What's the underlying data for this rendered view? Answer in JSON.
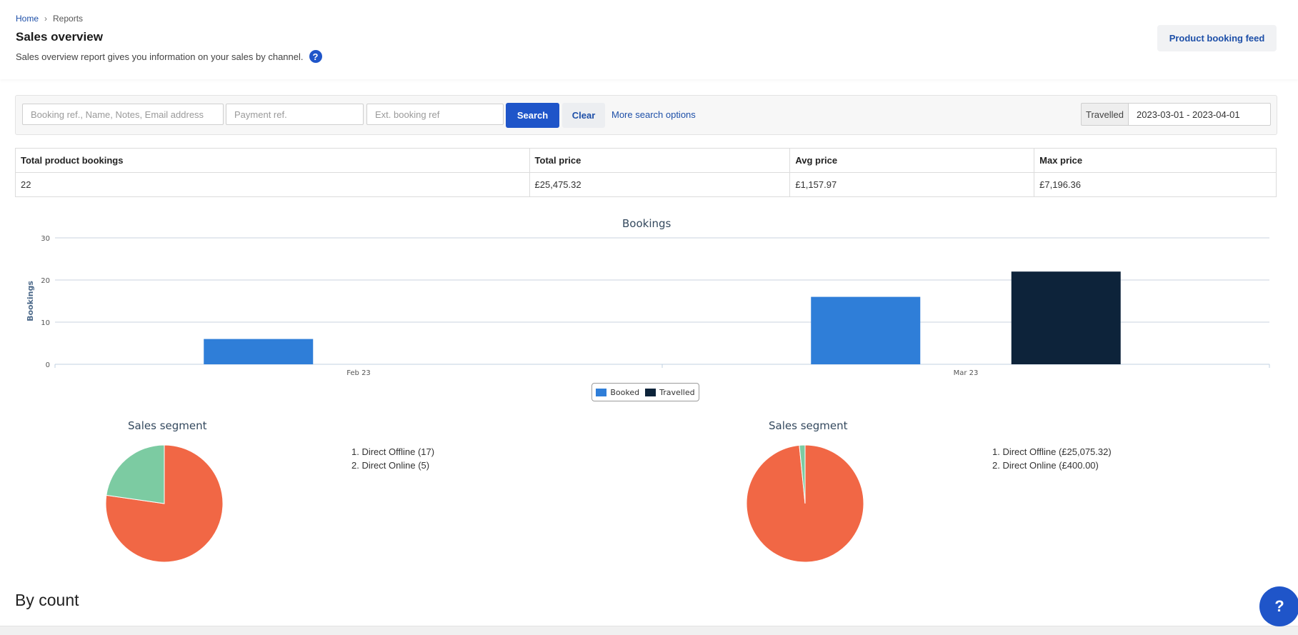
{
  "breadcrumb": {
    "home": "Home",
    "separator": "›",
    "current": "Reports"
  },
  "page": {
    "title": "Sales overview",
    "subtitle": "Sales overview report gives you information on your sales by channel.",
    "help_icon": "?",
    "feed_button": "Product booking feed"
  },
  "search": {
    "booking_placeholder": "Booking ref., Name, Notes, Email address",
    "payment_placeholder": "Payment ref.",
    "ext_placeholder": "Ext. booking ref",
    "search_label": "Search",
    "clear_label": "Clear",
    "more_label": "More search options",
    "date_type": "Travelled",
    "date_range": "2023-03-01 - 2023-04-01"
  },
  "summary": {
    "headers": [
      "Total product bookings",
      "Total price",
      "Avg price",
      "Max price"
    ],
    "values": [
      "22",
      "£25,475.32",
      "£1,157.97",
      "£7,196.36"
    ]
  },
  "colors": {
    "booked": "#2f7ed8",
    "travelled": "#0d233a",
    "offline": "#f16745",
    "online": "#7ccba2",
    "accent": "#1f55c9"
  },
  "chart_data": [
    {
      "type": "bar",
      "title": "Bookings",
      "ylabel": "Bookings",
      "xlabel": "",
      "categories": [
        "Feb 23",
        "Mar 23"
      ],
      "series": [
        {
          "name": "Booked",
          "values": [
            6,
            16
          ]
        },
        {
          "name": "Travelled",
          "values": [
            0,
            22
          ]
        }
      ],
      "ylim": [
        0,
        30
      ],
      "yticks": [
        0,
        10,
        20,
        30
      ],
      "grid": true,
      "legend": "bottom-center"
    },
    {
      "type": "pie",
      "title": "Sales segment",
      "labels": [
        "Direct Offline",
        "Direct Online"
      ],
      "values": [
        17,
        5
      ],
      "legend_items": [
        "1. Direct Offline (17)",
        "2. Direct Online (5)"
      ]
    },
    {
      "type": "pie",
      "title": "Sales segment",
      "labels": [
        "Direct Offline",
        "Direct Online"
      ],
      "values": [
        25075.32,
        400.0
      ],
      "legend_items": [
        "1. Direct Offline (£25,075.32)",
        "2. Direct Online (£400.00)"
      ]
    }
  ],
  "sections": {
    "by_count": "By count"
  },
  "fab": {
    "label": "?"
  }
}
